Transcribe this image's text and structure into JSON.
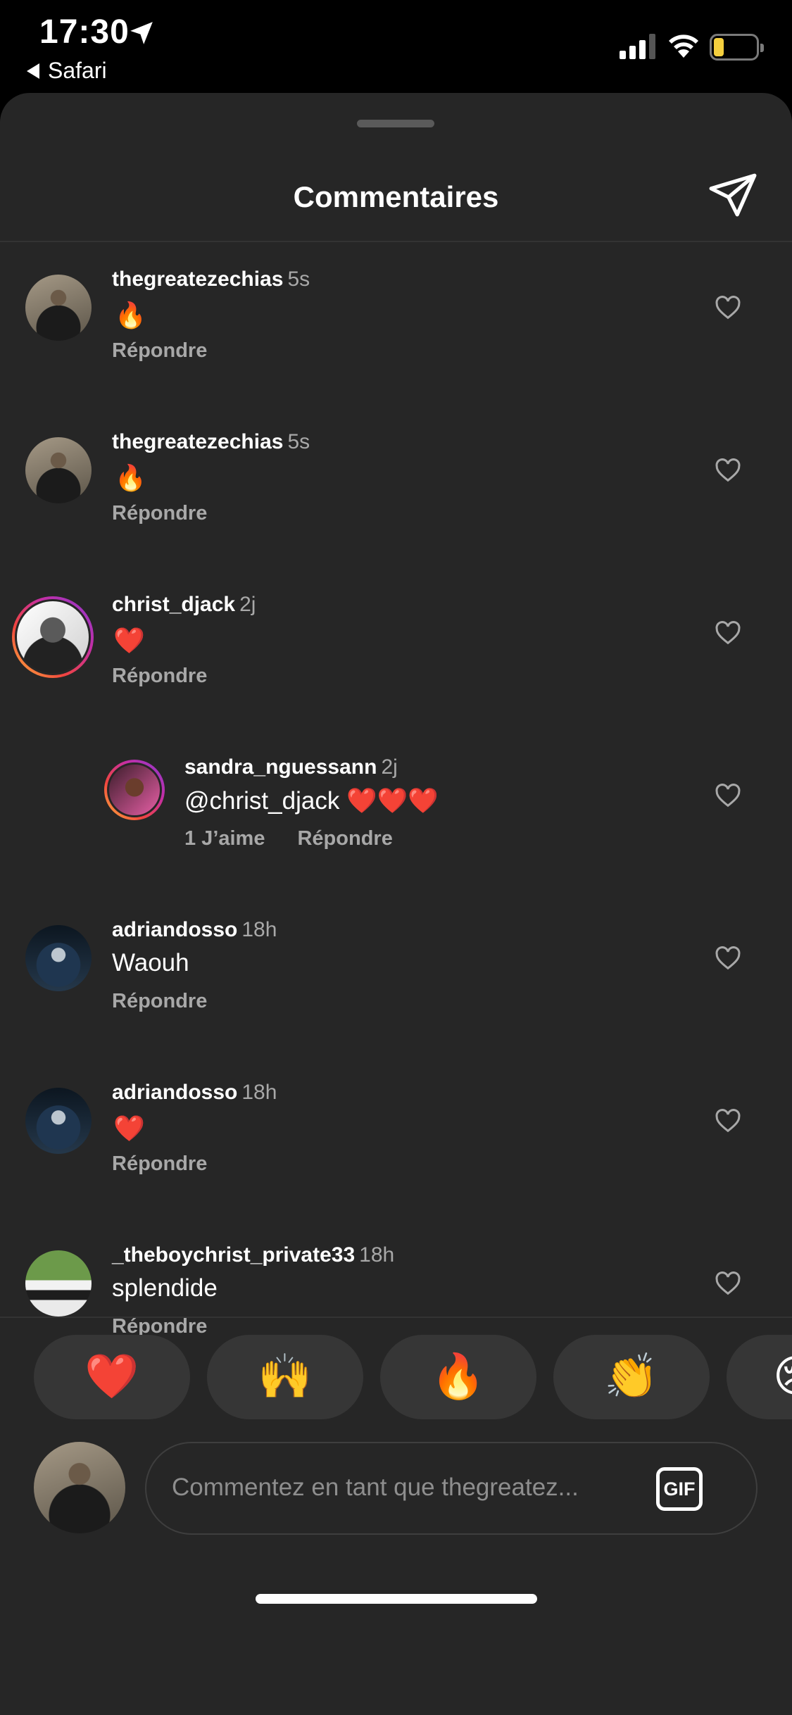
{
  "status_bar": {
    "time": "17:30",
    "back_app": "Safari",
    "battery": "18",
    "icons": [
      "location-arrow-icon",
      "cellular-signal-icon",
      "wifi-icon",
      "battery-icon"
    ]
  },
  "sheet": {
    "title": "Commentaires",
    "share_icon": "paper-plane-icon"
  },
  "comments": [
    {
      "username": "thegreatezechias",
      "time": "5s",
      "text": "🔥",
      "reply_label": "Répondre"
    },
    {
      "username": "thegreatezechias",
      "time": "5s",
      "text": "🔥",
      "reply_label": "Répondre"
    },
    {
      "username": "christ_djack",
      "time": "2j",
      "text": "❤️",
      "reply_label": "Répondre"
    },
    {
      "username": "sandra_nguessann",
      "time": "2j",
      "text": "@christ_djack ❤️❤️❤️",
      "likes_label": "1 J’aime",
      "reply_label": "Répondre"
    },
    {
      "username": "adriandosso",
      "time": "18h",
      "text": "Waouh",
      "reply_label": "Répondre"
    },
    {
      "username": "adriandosso",
      "time": "18h",
      "text": "❤️",
      "reply_label": "Répondre"
    },
    {
      "username": "_theboychrist_private33",
      "time": "18h",
      "text": "splendide",
      "reply_label": "Répondre"
    }
  ],
  "quick_reactions": [
    "❤️",
    "🙌",
    "🔥",
    "👏",
    "😢"
  ],
  "composer": {
    "placeholder": "Commentez en tant que thegreatez...",
    "gif_label": "GIF"
  },
  "colors": {
    "background": "#000000",
    "sheet": "#262626",
    "secondary_text": "#a8a8a8",
    "battery_yellow": "#f4cf3e"
  }
}
